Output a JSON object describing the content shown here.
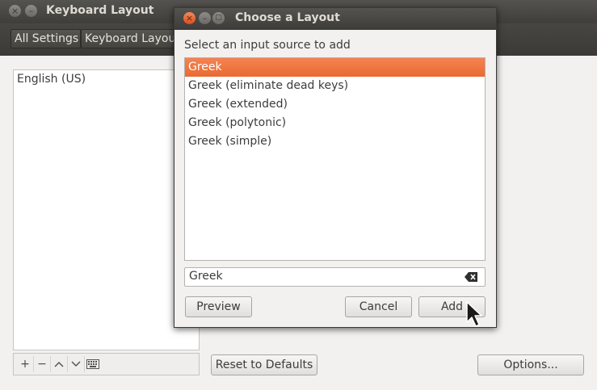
{
  "main_window": {
    "title": "Keyboard Layout",
    "breadcrumbs": [
      "All Settings",
      "Keyboard Layout"
    ],
    "input_sources": [
      "English (US)"
    ],
    "reset_label": "Reset to Defaults",
    "options_label": "Options...",
    "list_toolbar_icons": [
      "add-icon",
      "remove-icon",
      "move-up-icon",
      "move-down-icon",
      "keyboard-icon"
    ]
  },
  "dialog": {
    "title": "Choose a Layout",
    "prompt": "Select an input source to add",
    "layouts": [
      {
        "label": "Greek",
        "selected": true
      },
      {
        "label": "Greek (eliminate dead keys)",
        "selected": false
      },
      {
        "label": "Greek (extended)",
        "selected": false
      },
      {
        "label": "Greek (polytonic)",
        "selected": false
      },
      {
        "label": "Greek (simple)",
        "selected": false
      }
    ],
    "search_value": "Greek",
    "preview_label": "Preview",
    "cancel_label": "Cancel",
    "add_label": "Add"
  },
  "colors": {
    "selection": "#f07746",
    "close_button": "#e9602c",
    "titlebar": "#3c3b37"
  }
}
